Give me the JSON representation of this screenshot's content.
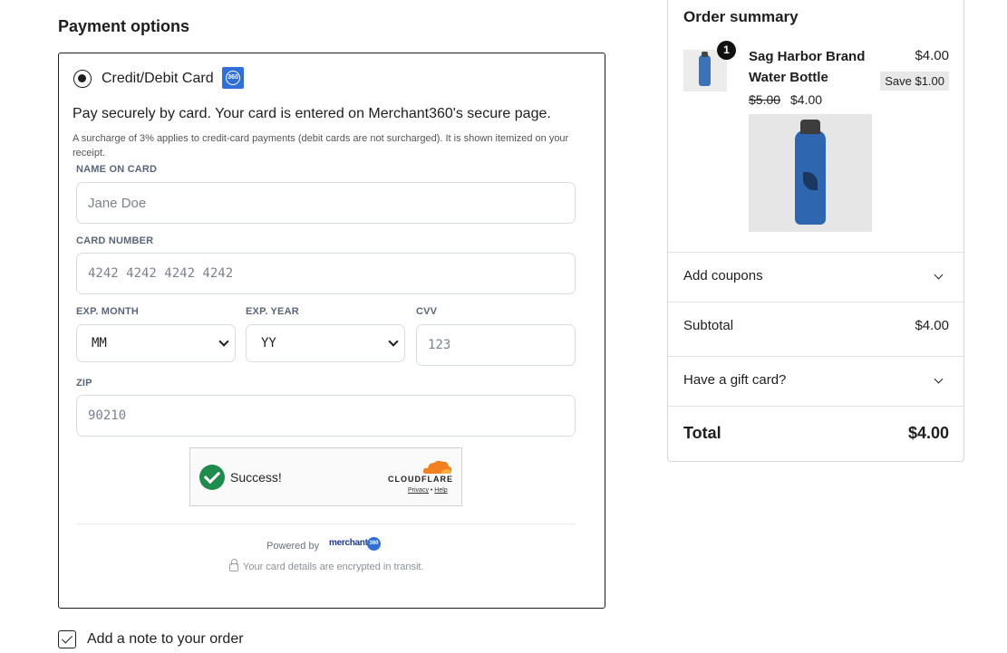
{
  "payment": {
    "title": "Payment options",
    "method_label": "Credit/Debit Card",
    "method_logo_text": "360",
    "description": "Pay securely by card. Your card is entered on Merchant360's secure page.",
    "surcharge_note": "A surcharge of 3% applies to credit-card payments (debit cards are not surcharged). It is shown itemized on your receipt.",
    "fields": {
      "name_label": "NAME ON CARD",
      "name_placeholder": "Jane Doe",
      "card_label": "CARD NUMBER",
      "card_placeholder": "4242 4242 4242 4242",
      "month_label": "EXP. MONTH",
      "month_value": "MM",
      "year_label": "EXP. YEAR",
      "year_value": "YY",
      "cvv_label": "CVV",
      "cvv_placeholder": "123",
      "zip_label": "ZIP",
      "zip_placeholder": "90210"
    },
    "captcha": {
      "status": "Success!",
      "brand": "CLOUDFLARE",
      "privacy": "Privacy",
      "separator": " • ",
      "help": "Help"
    },
    "powered_by": "Powered by",
    "processor": "merchant",
    "processor_badge": "360",
    "encrypted_note": "Your card details are encrypted in transit."
  },
  "note": {
    "label": "Add a note to your order",
    "checked": true
  },
  "summary": {
    "title": "Order summary",
    "item": {
      "quantity": "1",
      "name": "Sag Harbor Brand Water Bottle",
      "price": "$4.00",
      "save": "Save $1.00",
      "original_price": "$5.00",
      "sale_price": "$4.00"
    },
    "coupons_label": "Add coupons",
    "subtotal_label": "Subtotal",
    "subtotal_value": "$4.00",
    "gift_card_label": "Have a gift card?",
    "total_label": "Total",
    "total_value": "$4.00"
  },
  "colors": {
    "accent_blue": "#2f6fd6",
    "success_green": "#1f8b4c",
    "cloudflare_orange": "#f38020"
  }
}
